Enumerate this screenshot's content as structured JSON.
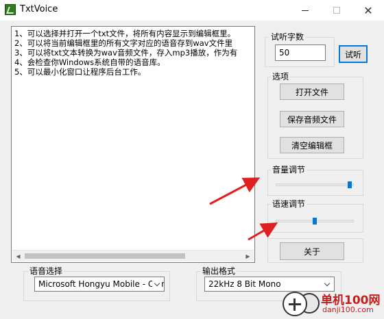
{
  "window": {
    "title": "TxtVoice",
    "min": "—",
    "max": "☐",
    "close": "✕"
  },
  "editor": {
    "lines": [
      "1、可以选择并打开一个txt文件，将所有内容显示到编辑框里。",
      "2、可以将当前编辑框里的所有文字对应的语音存到wav文件里",
      "3、可以将txt文本转换为wav音频文件，存入mp3播放，作为有",
      "4、会检查你Windows系统自带的语音库。",
      "5、可以最小化窗口让程序后台工作。"
    ]
  },
  "preview": {
    "legend": "试听字数",
    "value": "50",
    "button": "试听"
  },
  "options": {
    "legend": "选项",
    "open": "打开文件",
    "save": "保存音频文件",
    "clear": "清空编辑框"
  },
  "volume": {
    "legend": "音量调节",
    "level": 0.97
  },
  "speed": {
    "legend": "语速调节",
    "level": 0.5
  },
  "about": {
    "button": "关于"
  },
  "voice": {
    "legend": "语音选择",
    "selected": "Microsoft Hongyu Mobile - Chinese"
  },
  "output": {
    "legend": "输出格式",
    "selected": "22kHz 8 Bit Mono"
  },
  "watermark": {
    "title": "单机100网",
    "url": "danji100.com"
  },
  "colors": {
    "accent": "#0078d7",
    "arrow": "#e02020",
    "watermark": "#c81d1d"
  }
}
